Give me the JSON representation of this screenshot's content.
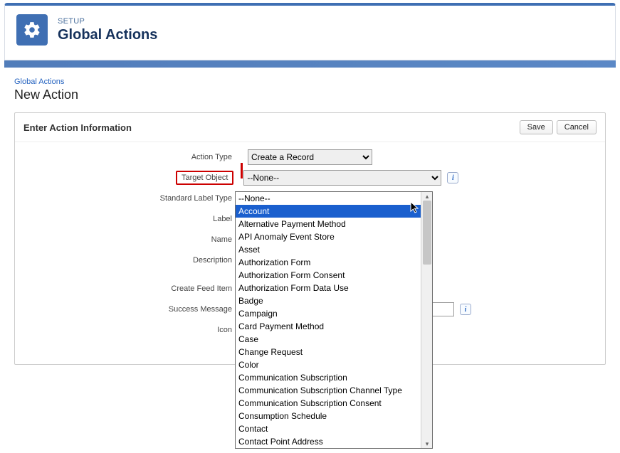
{
  "header": {
    "setup_label": "SETUP",
    "title": "Global Actions"
  },
  "breadcrumb": {
    "parent": "Global Actions"
  },
  "subtitle": "New Action",
  "form": {
    "section_title": "Enter Action Information",
    "save_label": "Save",
    "cancel_label": "Cancel",
    "labels": {
      "action_type": "Action Type",
      "target_object": "Target Object",
      "standard_label_type": "Standard Label Type",
      "label": "Label",
      "name": "Name",
      "description": "Description",
      "create_feed_item": "Create Feed Item",
      "success_message": "Success Message",
      "icon": "Icon"
    },
    "action_type_value": "Create a Record",
    "target_object_value": "--None--"
  },
  "dropdown": {
    "highlighted_index": 1,
    "options": [
      "--None--",
      "Account",
      "Alternative Payment Method",
      "API Anomaly Event Store",
      "Asset",
      "Authorization Form",
      "Authorization Form Consent",
      "Authorization Form Data Use",
      "Badge",
      "Campaign",
      "Card Payment Method",
      "Case",
      "Change Request",
      "Color",
      "Communication Subscription",
      "Communication Subscription Channel Type",
      "Communication Subscription Consent",
      "Consumption Schedule",
      "Contact",
      "Contact Point Address"
    ]
  },
  "colors": {
    "accent": "#3f6fb3",
    "highlight_border": "#c00",
    "selection": "#1a5fce"
  }
}
